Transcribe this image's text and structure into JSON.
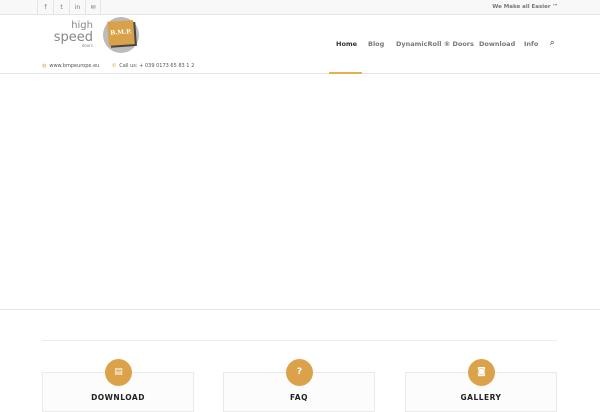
{
  "topbar": {
    "social": [
      {
        "name": "facebook-icon",
        "glyph": "f"
      },
      {
        "name": "twitter-icon",
        "glyph": "t"
      },
      {
        "name": "linkedin-icon",
        "glyph": "in"
      },
      {
        "name": "mail-icon",
        "glyph": "✉"
      }
    ],
    "tagline": "We Make all Easier ™"
  },
  "logo": {
    "high": "high",
    "speed": "speed",
    "doors": "doors",
    "badge": "B.M.P."
  },
  "contact": {
    "website": "www.bmpeurope.eu",
    "phone": "Call us: + 039 0173 65 83 1 2"
  },
  "nav": {
    "items": [
      "Home",
      "Blog",
      "DynamicRoll ® Doors",
      "Download",
      "Info"
    ],
    "search_icon": "⌕"
  },
  "cards": [
    {
      "title": "DOWNLOAD",
      "icon": "▤"
    },
    {
      "title": "FAQ",
      "icon": "?"
    },
    {
      "title": "GALLERY",
      "icon": "◙"
    }
  ],
  "colors": {
    "accent": "#dca24a"
  }
}
